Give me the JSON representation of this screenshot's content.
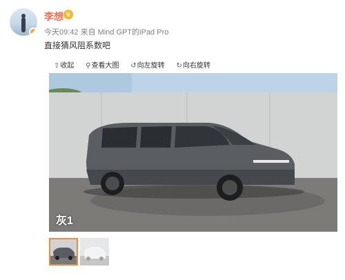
{
  "post": {
    "author": "李想",
    "time": "今天09:42",
    "source": "来自 Mind GPT的iPad Pro",
    "text": "直接猜风阻系数吧"
  },
  "toolbar": {
    "collapse_label": "收起",
    "view_large_label": "查看大图",
    "rotate_left_label": "向左旋转",
    "rotate_right_label": "向右旋转"
  },
  "image": {
    "caption": "灰1"
  },
  "colors": {
    "author_name": "#eb7350",
    "thumb_selected_border": "#f08a3c"
  }
}
